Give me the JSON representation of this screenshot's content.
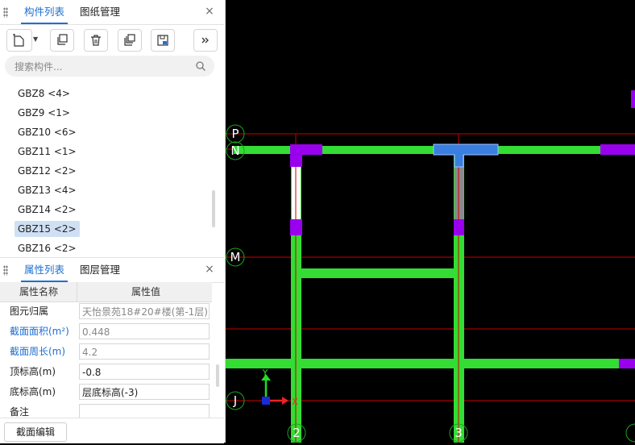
{
  "top_panel": {
    "tabs": [
      {
        "label": "构件列表"
      },
      {
        "label": "图纸管理"
      }
    ],
    "close": "×"
  },
  "search": {
    "placeholder": "搜索构件..."
  },
  "components": [
    {
      "label": "GBZ8 <4>"
    },
    {
      "label": "GBZ9 <1>"
    },
    {
      "label": "GBZ10 <6>"
    },
    {
      "label": "GBZ11 <1>"
    },
    {
      "label": "GBZ12 <2>"
    },
    {
      "label": "GBZ13 <4>"
    },
    {
      "label": "GBZ14 <2>"
    },
    {
      "label": "GBZ15 <2>",
      "selected": true
    },
    {
      "label": "GBZ16 <2>"
    }
  ],
  "bottom_panel": {
    "tabs": [
      {
        "label": "属性列表"
      },
      {
        "label": "图层管理"
      }
    ],
    "close": "×",
    "header": {
      "name": "属性名称",
      "value": "属性值"
    },
    "rows": [
      {
        "name": "图元归属",
        "value": "天怡景苑18#20#楼(第-1层)",
        "blue": false,
        "readonly": true
      },
      {
        "name": "截面面积(m²)",
        "value": "0.448",
        "blue": true,
        "readonly": true
      },
      {
        "name": "截面周长(m)",
        "value": "4.2",
        "blue": true,
        "readonly": true
      },
      {
        "name": "顶标高(m)",
        "value": "-0.8",
        "blue": false,
        "readonly": false
      },
      {
        "name": "底标高(m)",
        "value": "层底标高(-3)",
        "blue": false,
        "readonly": false
      },
      {
        "name": "备注",
        "value": "",
        "blue": false,
        "readonly": false
      }
    ]
  },
  "buttons": {
    "section_edit": "截面编辑"
  },
  "canvas": {
    "axis_labels": {
      "P": "P",
      "N": "N",
      "M": "M",
      "J": "J",
      "c2": "2",
      "c3": "3",
      "ucs_x": "X",
      "ucs_y": "Y"
    },
    "colors": {
      "background": "#000000",
      "wall": "#33dd33",
      "column": "#9900ee",
      "axis": "#cc0000",
      "selected": "#3a7fe0",
      "bubble": "#1aa51a"
    }
  }
}
